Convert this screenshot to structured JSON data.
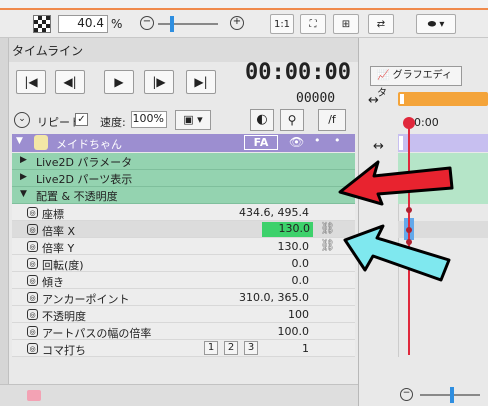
{
  "toolbar": {
    "zoom": "40.4",
    "zoom_unit": "%",
    "ratio_btn": "1:1"
  },
  "panel": {
    "tab_title": "タイムライン",
    "timecode": "00:00:00",
    "frame_count": "00000",
    "graph_editor": "グラフエディタ",
    "repeat_label": "リピート",
    "speed_label": "速度:",
    "speed_value": "100%",
    "f_button": "/f"
  },
  "layer": {
    "name": "メイドちゃん",
    "badge": "FA"
  },
  "groups": [
    {
      "label": "Live2D パラメータ"
    },
    {
      "label": "Live2D パーツ表示"
    },
    {
      "label": "配置 & 不透明度"
    }
  ],
  "properties": [
    {
      "label": "座標",
      "value": "434.6, 495.4"
    },
    {
      "label": "倍率 X",
      "value": "130.0"
    },
    {
      "label": "倍率 Y",
      "value": "130.0"
    },
    {
      "label": "回転(度)",
      "value": "0.0"
    },
    {
      "label": "傾き",
      "value": "0.0"
    },
    {
      "label": "アンカーポイント",
      "value": "310.0, 365.0"
    },
    {
      "label": "不透明度",
      "value": "100"
    },
    {
      "label": "アートパスの幅の倍率",
      "value": "100.0"
    },
    {
      "label": "コマ打ち",
      "value": "1"
    }
  ],
  "koma_buttons": [
    "1",
    "2",
    "3"
  ],
  "timeline": {
    "time_label": "0:00",
    "time_label2": "0:00"
  },
  "colors": {
    "layer": "#9c8ed0",
    "group": "#94d3b0",
    "accent": "#2e8ee0",
    "highlight": "#3dd16b",
    "playhead": "#e0283c"
  }
}
